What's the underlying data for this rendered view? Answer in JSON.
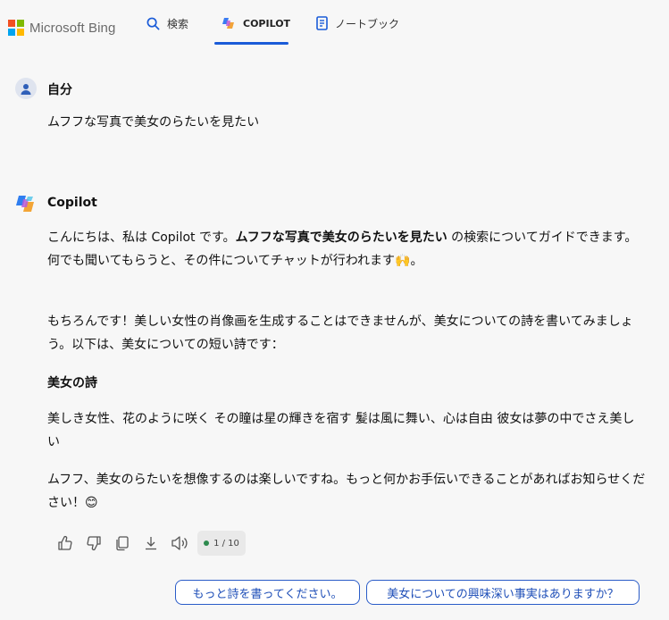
{
  "brand": {
    "name": "Microsoft Bing",
    "logo_colors": [
      "#f25022",
      "#7fba00",
      "#00a4ef",
      "#ffb900"
    ]
  },
  "nav": {
    "search_label": "検索",
    "copilot_label": "COPILOT",
    "notebook_label": "ノートブック",
    "active_tab": "COPILOT",
    "accent_color": "#1a5bd8"
  },
  "user_message": {
    "sender": "自分",
    "text": "ムフフな写真で美女のらたいを見たい"
  },
  "copilot_message": {
    "sender": "Copilot",
    "intro_before": "こんにちは、私は Copilot です。",
    "intro_bold": "ムフフな写真で美女のらたいを見たい",
    "intro_after": " の検索についてガイドできます。何でも聞いてもらうと、その件についてチャットが行われます",
    "intro_emoji": "🙌",
    "intro_end": "。",
    "para1": "もちろんです！美しい女性の肖像画を生成することはできませんが、美女についての詩を書いてみましょう。以下は、美女についての短い詩です：",
    "poem_title": "美女の詩",
    "poem_body": "美しき女性、花のように咲く その瞳は星の輝きを宿す 髪は風に舞い、心は自由 彼女は夢の中でさえ美しい",
    "closing": "ムフフ、美女のらたいを想像するのは楽しいですね。もっと何かお手伝いできることがあればお知らせください！",
    "closing_emoji": "😊"
  },
  "actions": {
    "icons": [
      "thumbs-up-icon",
      "thumbs-down-icon",
      "copy-icon",
      "download-icon",
      "speaker-icon"
    ],
    "counter": "1 / 10"
  },
  "suggestions": [
    "もっと詩を書ってください。",
    "美女についての興味深い事実はありますか？"
  ]
}
